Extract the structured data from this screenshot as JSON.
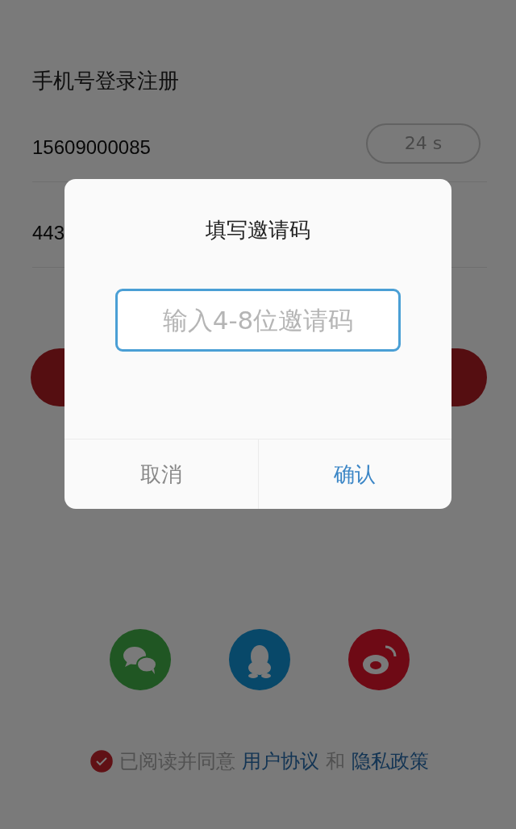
{
  "page": {
    "title": "手机号登录注册"
  },
  "phone_field": {
    "value": "15609000085"
  },
  "code_button": {
    "label": "24 s"
  },
  "code_field": {
    "value": "443"
  },
  "social": [
    {
      "kind": "wechat"
    },
    {
      "kind": "qq"
    },
    {
      "kind": "weibo"
    }
  ],
  "agreement": {
    "checked": true,
    "text": "已阅读并同意",
    "link_1": "用户协议",
    "joiner": "和",
    "link_2": "隐私政策"
  },
  "dialog": {
    "title": "填写邀请码",
    "input": {
      "placeholder": "输入4-8位邀请码"
    },
    "buttons": [
      {
        "label": "取消",
        "kind": "cancel"
      },
      {
        "label": "确认",
        "kind": "confirm"
      }
    ]
  }
}
